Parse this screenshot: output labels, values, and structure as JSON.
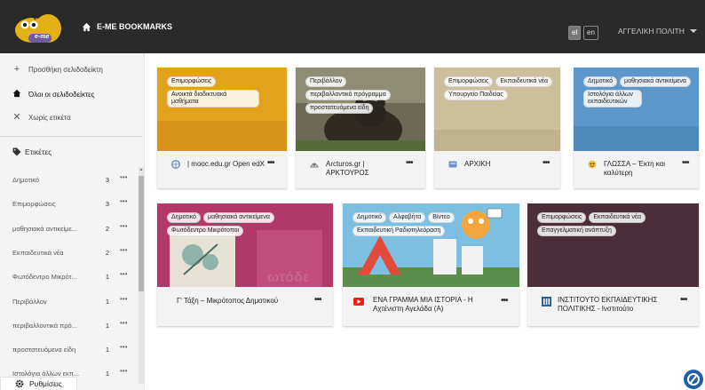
{
  "header": {
    "brand_title": "E-ME BOOKMARKS",
    "logo_text": "e-me",
    "lang_el": "el",
    "lang_en": "en",
    "user_name": "ΑΓΓΕΛΙΚΗ ΠΟΛΙΤΗ",
    "icons": {
      "home": "home-icon",
      "caret": "caret-down-icon"
    }
  },
  "sidebar": {
    "add_label": "Προσθήκη σελιδοδείκτη",
    "all_label": "Όλοι οι σελιδοδείκτες",
    "untagged_label": "Χωρίς ετικέτα",
    "tags_title": "Ετικέτες",
    "tags": [
      {
        "name": "Δημοτικό",
        "count": "3"
      },
      {
        "name": "Επιμορφώσεις",
        "count": "3"
      },
      {
        "name": "μαθησιακά αντικείμε...",
        "count": "2"
      },
      {
        "name": "Εκπαιδευτικά νέα",
        "count": "2"
      },
      {
        "name": "Φωτόδεντρο Μικρότ...",
        "count": "1"
      },
      {
        "name": "Περιβάλλον",
        "count": "1"
      },
      {
        "name": "περιβαλλοντικά πρό...",
        "count": "1"
      },
      {
        "name": "προστατευόμενα είδη",
        "count": "1"
      },
      {
        "name": "Ιστολόγια άλλων εκπ...",
        "count": "1"
      }
    ],
    "more_glyph": "•••",
    "settings_label": "Ρυθμίσεις"
  },
  "cards": [
    {
      "tags": [
        "Επιμορφώσεις",
        "Ανοικτά διαδικτυακά μαθήματα"
      ],
      "title": "| mooc.edu.gr Open edX",
      "thumb_color": "#e3a21b",
      "favicon": "globe-icon"
    },
    {
      "tags": [
        "Περιβάλλον",
        "περιβαλλοντικό πρόγραμμα",
        "προστατευόμενα είδη"
      ],
      "title": "Arcturos.gr | ΑΡΚΤΟΥΡΟΣ",
      "thumb_color": "#4e4a3c",
      "favicon": "arcturos-icon"
    },
    {
      "tags": [
        "Επιμορφώσεις",
        "Εκπαιδευτικά νέα",
        "Υπουργείο Παιδείας"
      ],
      "title": "ΑΡΧΙΚΗ",
      "thumb_color": "#cbbf9c",
      "favicon": "ministry-icon"
    },
    {
      "tags": [
        "Δημοτικό",
        "μαθησιακά αντικείμενα",
        "Ιστολόγια άλλων εκπαιδευτικών"
      ],
      "title": "ΓΛΩΣΣΑ – Έκτη και καλύτερη",
      "thumb_color": "#5b97c8",
      "favicon": "blog-icon"
    },
    {
      "tags": [
        "Δημοτικό",
        "μαθησιακά αντικείμενα",
        "Φωτόδεντρο Μικρότοποι"
      ],
      "title": "Γ' Τάξη – Μικρότοπος Δημοτικού",
      "thumb_color": "#b3386a",
      "favicon": ""
    },
    {
      "tags": [
        "Δημοτικό",
        "Αλφαβήτα",
        "Βίντεο",
        "Εκπαιδευτική Ραδιοτηλεόραση"
      ],
      "title": "ΕΝΑ ΓΡΑΜΜΑ ΜΙΑ ΙΣΤΟΡΙΑ - Η Αχτένιστη Αγελάδα (Α)",
      "thumb_color": "#68a8cf",
      "favicon": "youtube-icon"
    },
    {
      "tags": [
        "Επιμορφώσεις",
        "Εκπαιδευτικά νέα",
        "Επαγγελματική ανάπτυξη"
      ],
      "title": "ΙΝΣΤΙΤΟΥΤΟ ΕΚΠΑΙΔΕΥΤΙΚΗΣ ΠΟΛΙΤΙΚΗΣ - Ινστιτούτο",
      "thumb_color": "#4c2e3b",
      "favicon": "iep-icon"
    }
  ],
  "colors": {
    "topbar": "#2a2a2a",
    "sidebar": "#f4f4f4",
    "fab": "#1f5fa8"
  }
}
